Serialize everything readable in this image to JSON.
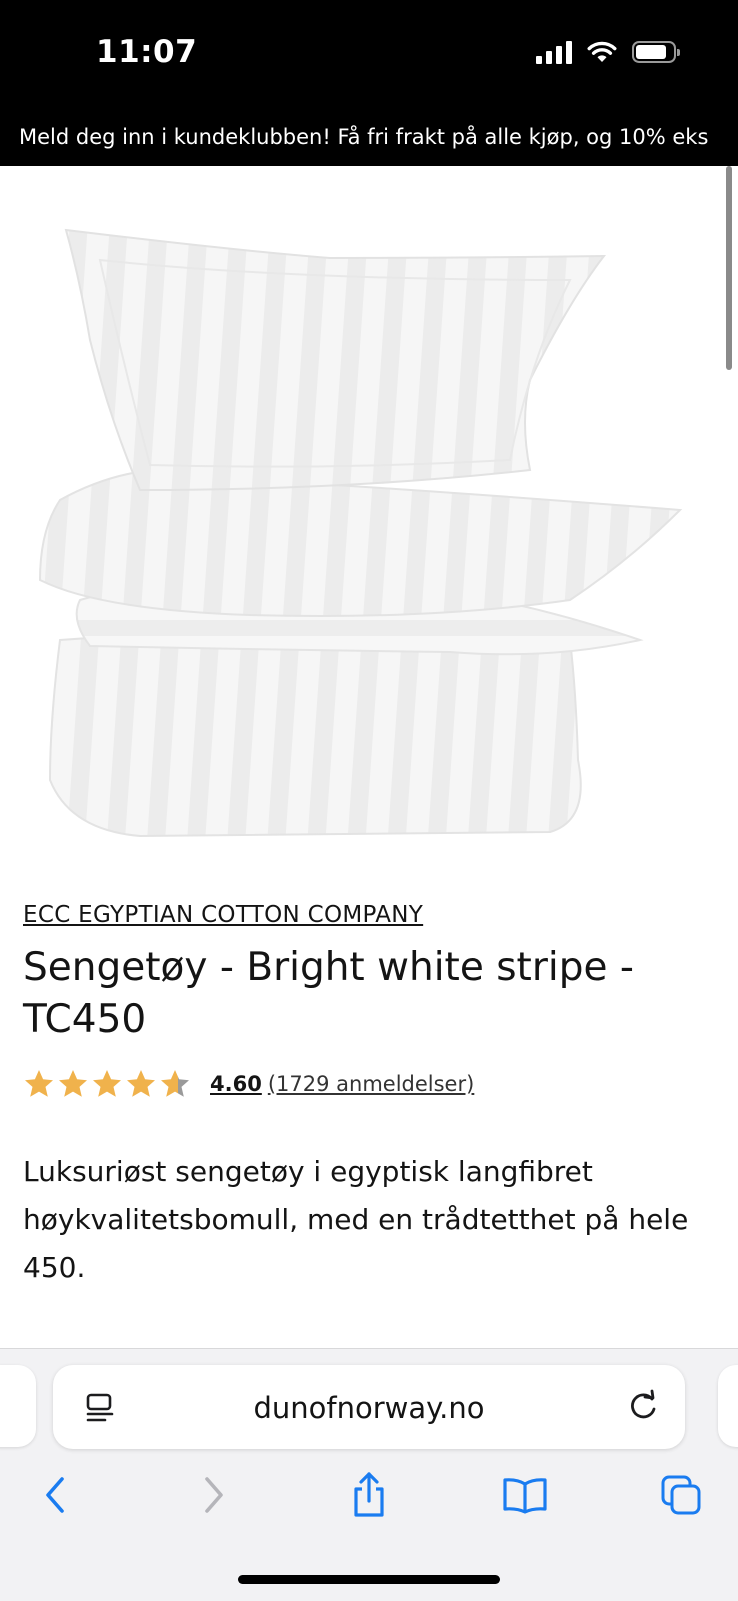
{
  "status_bar": {
    "time": "11:07"
  },
  "announcement": {
    "text": "Meld deg inn i kundeklubben! Få fri frakt på alle kjøp, og 10% eks"
  },
  "product": {
    "brand": "ECC EGYPTIAN COTTON COMPANY",
    "title": "Sengetøy - Bright white stripe - TC450",
    "rating": {
      "value": "4.60",
      "reviews": "(1729 anmeldelser)",
      "stars_out_of_5": 4.6
    },
    "description": "Luksuriøst sengetøy i egyptisk langfibret høykvalitetsbomull, med en trådtetthet på hele 450.",
    "image": "white-striped-bedding-set"
  },
  "browser": {
    "url": "dunofnorway.no",
    "toolbar": [
      "back",
      "forward",
      "share",
      "bookmarks",
      "tabs"
    ]
  },
  "colors": {
    "star": "#F0B24C",
    "star_empty": "#9a9a9a",
    "browser_accent": "#1A7CF0",
    "status_bar_bg": "#000000",
    "announcement_bg": "#000000"
  }
}
